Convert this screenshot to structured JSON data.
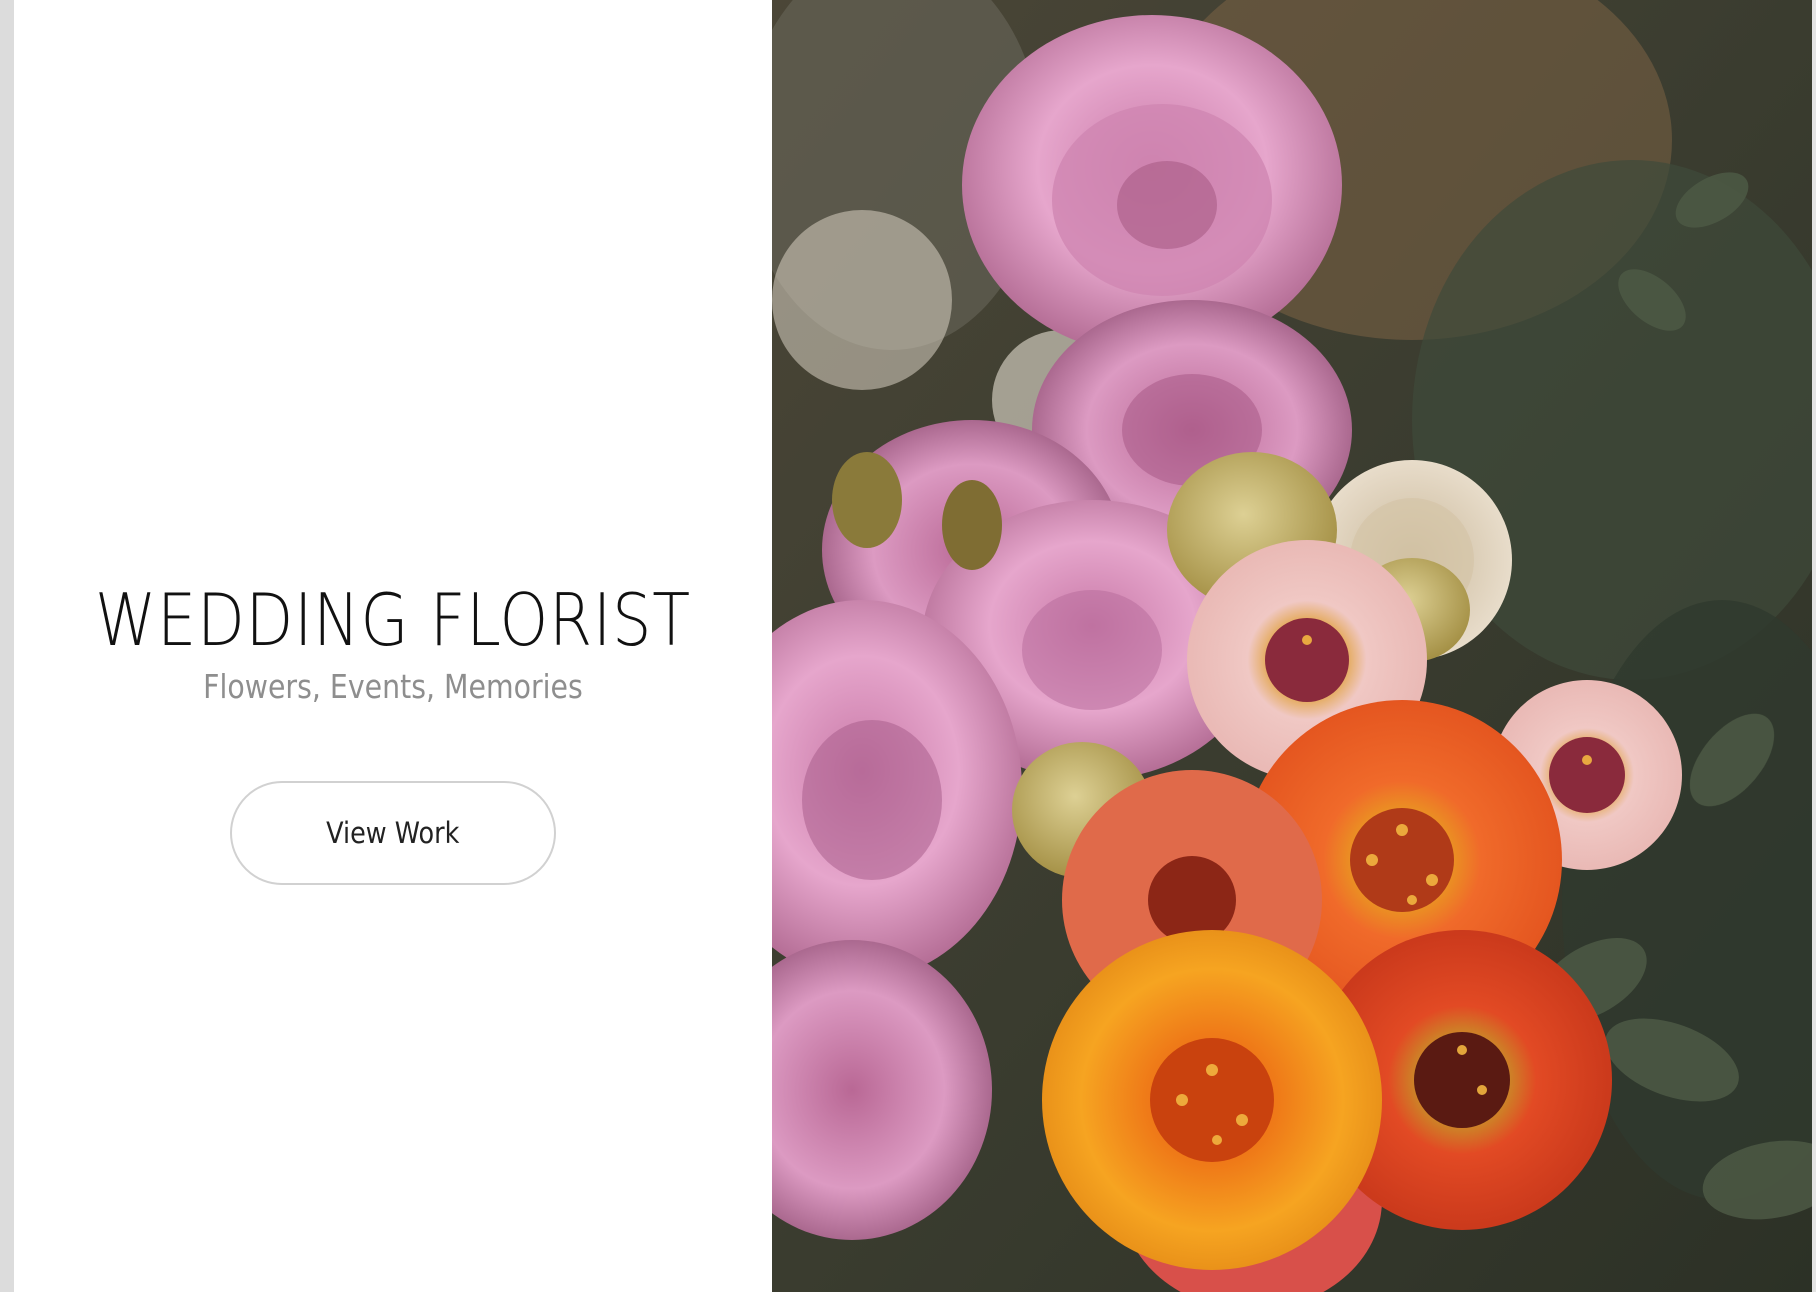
{
  "hero": {
    "title": "WEDDING FLORIST",
    "subtitle": "Flowers, Events, Memories",
    "cta_label": "View Work"
  },
  "colors": {
    "background": "#ffffff",
    "title": "#111111",
    "subtitle": "#8e8e8e",
    "button_border": "#d1d1d1"
  }
}
